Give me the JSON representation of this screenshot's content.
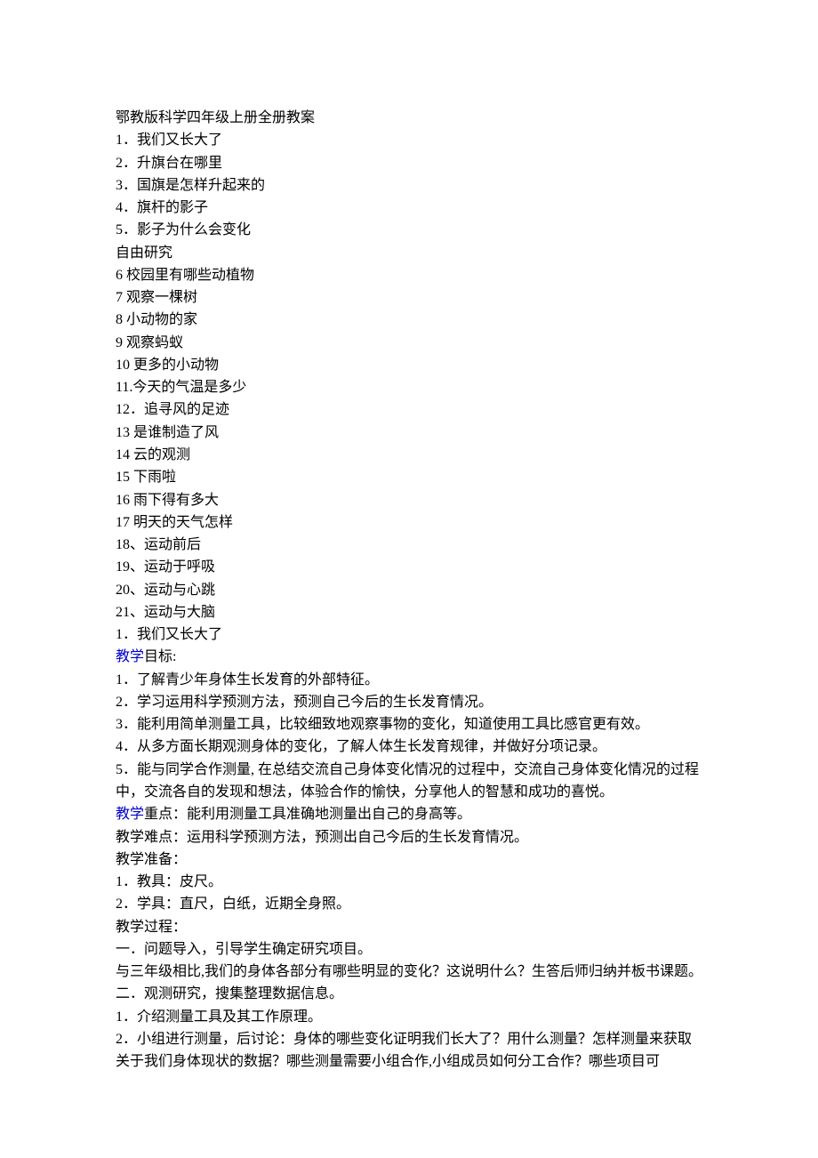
{
  "title": "鄂教版科学四年级上册全册教案",
  "toc": [
    "1．我们又长大了",
    "2．升旗台在哪里",
    "3．国旗是怎样升起来的",
    "4．旗杆的影子",
    "5．影子为什么会变化",
    "自由研究",
    "6   校园里有哪些动植物",
    "7   观察一棵树",
    "8   小动物的家",
    "9   观察蚂蚁",
    "10   更多的小动物",
    "11.今天的气温是多少",
    "12．追寻风的足迹",
    "13 是谁制造了风",
    "14  云的观测",
    "15 下雨啦",
    "16 雨下得有多大",
    "17 明天的天气怎样",
    "18、运动前后",
    "19、运动于呼吸",
    "20、运动与心跳",
    "21、运动与大脑"
  ],
  "lesson1_title": "1．我们又长大了",
  "sections": {
    "goals_label_prefix": "教学",
    "goals_label_suffix": "目标:",
    "goals": [
      "1．了解青少年身体生长发育的外部特征。",
      "2．学习运用科学预测方法，预测自己今后的生长发育情况。",
      "3．能利用简单测量工具，比较细致地观察事物的变化，知道使用工具比感官更有效。",
      "4．从多方面长期观测身体的变化，了解人体生长发育规律，并做好分项记录。",
      "5．能与同学合作测量, 在总结交流自己身体变化情况的过程中，交流自己身体变化情况的过程中，交流各自的发现和想法，体验合作的愉快，分享他人的智慧和成功的喜悦。"
    ],
    "keypoint_label_prefix": "教学",
    "keypoint_label_suffix": "重点：能利用测量工具准确地测量出自己的身高等。",
    "difficulty": "教学难点：运用科学预测方法，预测出自己今后的生长发育情况。",
    "prep_label": "教学准备：",
    "prep": [
      "1．教具：皮尺。",
      "2．学具：直尺，白纸，近期全身照。"
    ],
    "process_label": "教学过程：",
    "process": [
      "一．问题导入，引导学生确定研究项目。",
      "与三年级相比,我们的身体各部分有哪些明显的变化？这说明什么？生答后师归纳并板书课题。",
      "二．观测研究，搜集整理数据信息。",
      "1．介绍测量工具及其工作原理。",
      "2．小组进行测量，后讨论：身体的哪些变化证明我们长大了？用什么测量？怎样测量来获取关于我们身体现状的数据？哪些测量需要小组合作,小组成员如何分工合作？哪些项目可"
    ]
  }
}
